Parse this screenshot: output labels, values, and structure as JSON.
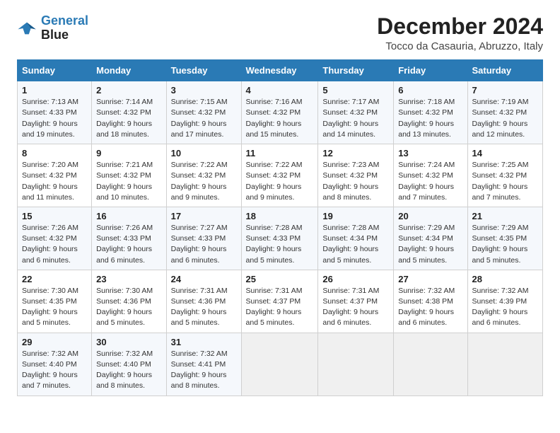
{
  "logo": {
    "line1": "General",
    "line2": "Blue"
  },
  "header": {
    "month": "December 2024",
    "location": "Tocco da Casauria, Abruzzo, Italy"
  },
  "weekdays": [
    "Sunday",
    "Monday",
    "Tuesday",
    "Wednesday",
    "Thursday",
    "Friday",
    "Saturday"
  ],
  "weeks": [
    [
      {
        "day": "1",
        "sunrise": "7:13 AM",
        "sunset": "4:33 PM",
        "daylight": "9 hours and 19 minutes."
      },
      {
        "day": "2",
        "sunrise": "7:14 AM",
        "sunset": "4:32 PM",
        "daylight": "9 hours and 18 minutes."
      },
      {
        "day": "3",
        "sunrise": "7:15 AM",
        "sunset": "4:32 PM",
        "daylight": "9 hours and 17 minutes."
      },
      {
        "day": "4",
        "sunrise": "7:16 AM",
        "sunset": "4:32 PM",
        "daylight": "9 hours and 15 minutes."
      },
      {
        "day": "5",
        "sunrise": "7:17 AM",
        "sunset": "4:32 PM",
        "daylight": "9 hours and 14 minutes."
      },
      {
        "day": "6",
        "sunrise": "7:18 AM",
        "sunset": "4:32 PM",
        "daylight": "9 hours and 13 minutes."
      },
      {
        "day": "7",
        "sunrise": "7:19 AM",
        "sunset": "4:32 PM",
        "daylight": "9 hours and 12 minutes."
      }
    ],
    [
      {
        "day": "8",
        "sunrise": "7:20 AM",
        "sunset": "4:32 PM",
        "daylight": "9 hours and 11 minutes."
      },
      {
        "day": "9",
        "sunrise": "7:21 AM",
        "sunset": "4:32 PM",
        "daylight": "9 hours and 10 minutes."
      },
      {
        "day": "10",
        "sunrise": "7:22 AM",
        "sunset": "4:32 PM",
        "daylight": "9 hours and 9 minutes."
      },
      {
        "day": "11",
        "sunrise": "7:22 AM",
        "sunset": "4:32 PM",
        "daylight": "9 hours and 9 minutes."
      },
      {
        "day": "12",
        "sunrise": "7:23 AM",
        "sunset": "4:32 PM",
        "daylight": "9 hours and 8 minutes."
      },
      {
        "day": "13",
        "sunrise": "7:24 AM",
        "sunset": "4:32 PM",
        "daylight": "9 hours and 7 minutes."
      },
      {
        "day": "14",
        "sunrise": "7:25 AM",
        "sunset": "4:32 PM",
        "daylight": "9 hours and 7 minutes."
      }
    ],
    [
      {
        "day": "15",
        "sunrise": "7:26 AM",
        "sunset": "4:32 PM",
        "daylight": "9 hours and 6 minutes."
      },
      {
        "day": "16",
        "sunrise": "7:26 AM",
        "sunset": "4:33 PM",
        "daylight": "9 hours and 6 minutes."
      },
      {
        "day": "17",
        "sunrise": "7:27 AM",
        "sunset": "4:33 PM",
        "daylight": "9 hours and 6 minutes."
      },
      {
        "day": "18",
        "sunrise": "7:28 AM",
        "sunset": "4:33 PM",
        "daylight": "9 hours and 5 minutes."
      },
      {
        "day": "19",
        "sunrise": "7:28 AM",
        "sunset": "4:34 PM",
        "daylight": "9 hours and 5 minutes."
      },
      {
        "day": "20",
        "sunrise": "7:29 AM",
        "sunset": "4:34 PM",
        "daylight": "9 hours and 5 minutes."
      },
      {
        "day": "21",
        "sunrise": "7:29 AM",
        "sunset": "4:35 PM",
        "daylight": "9 hours and 5 minutes."
      }
    ],
    [
      {
        "day": "22",
        "sunrise": "7:30 AM",
        "sunset": "4:35 PM",
        "daylight": "9 hours and 5 minutes."
      },
      {
        "day": "23",
        "sunrise": "7:30 AM",
        "sunset": "4:36 PM",
        "daylight": "9 hours and 5 minutes."
      },
      {
        "day": "24",
        "sunrise": "7:31 AM",
        "sunset": "4:36 PM",
        "daylight": "9 hours and 5 minutes."
      },
      {
        "day": "25",
        "sunrise": "7:31 AM",
        "sunset": "4:37 PM",
        "daylight": "9 hours and 5 minutes."
      },
      {
        "day": "26",
        "sunrise": "7:31 AM",
        "sunset": "4:37 PM",
        "daylight": "9 hours and 6 minutes."
      },
      {
        "day": "27",
        "sunrise": "7:32 AM",
        "sunset": "4:38 PM",
        "daylight": "9 hours and 6 minutes."
      },
      {
        "day": "28",
        "sunrise": "7:32 AM",
        "sunset": "4:39 PM",
        "daylight": "9 hours and 6 minutes."
      }
    ],
    [
      {
        "day": "29",
        "sunrise": "7:32 AM",
        "sunset": "4:40 PM",
        "daylight": "9 hours and 7 minutes."
      },
      {
        "day": "30",
        "sunrise": "7:32 AM",
        "sunset": "4:40 PM",
        "daylight": "9 hours and 8 minutes."
      },
      {
        "day": "31",
        "sunrise": "7:32 AM",
        "sunset": "4:41 PM",
        "daylight": "9 hours and 8 minutes."
      },
      null,
      null,
      null,
      null
    ]
  ],
  "labels": {
    "sunrise": "Sunrise:",
    "sunset": "Sunset:",
    "daylight": "Daylight:"
  }
}
